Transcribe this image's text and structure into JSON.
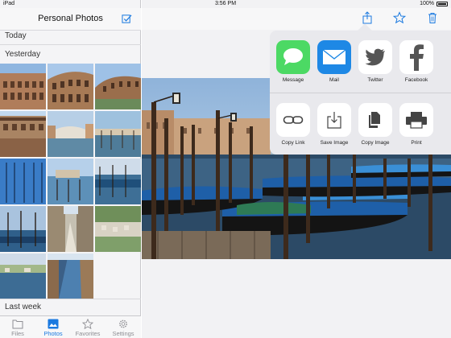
{
  "status_bar": {
    "device": "iPad",
    "time": "3:56 PM",
    "battery": "100%"
  },
  "sidebar": {
    "title": "Personal Photos",
    "sections": {
      "today": "Today",
      "yesterday": "Yesterday",
      "last_week": "Last week"
    }
  },
  "tabbar": {
    "tabs": [
      {
        "label": "Files",
        "icon": "files-icon",
        "active": false
      },
      {
        "label": "Photos",
        "icon": "photos-icon",
        "active": true
      },
      {
        "label": "Favorites",
        "icon": "star-icon",
        "active": false
      },
      {
        "label": "Settings",
        "icon": "gear-icon",
        "active": false
      }
    ]
  },
  "toolbar": {
    "icons": [
      "share-icon",
      "favorite-star-icon",
      "trash-icon"
    ]
  },
  "share_sheet": {
    "apps": [
      {
        "label": "Message",
        "icon": "message-icon"
      },
      {
        "label": "Mail",
        "icon": "mail-icon"
      },
      {
        "label": "Twitter",
        "icon": "twitter-icon"
      },
      {
        "label": "Facebook",
        "icon": "facebook-icon"
      }
    ],
    "actions": [
      {
        "label": "Copy Link",
        "icon": "link-icon"
      },
      {
        "label": "Save Image",
        "icon": "save-image-icon"
      },
      {
        "label": "Copy Image",
        "icon": "copy-image-icon"
      },
      {
        "label": "Print",
        "icon": "print-icon"
      }
    ]
  },
  "colors": {
    "accent": "#1b7ae0",
    "message_green": "#4cd964",
    "mail_blue": "#1e88e5",
    "sheet_bg": "#e9e9ed"
  }
}
